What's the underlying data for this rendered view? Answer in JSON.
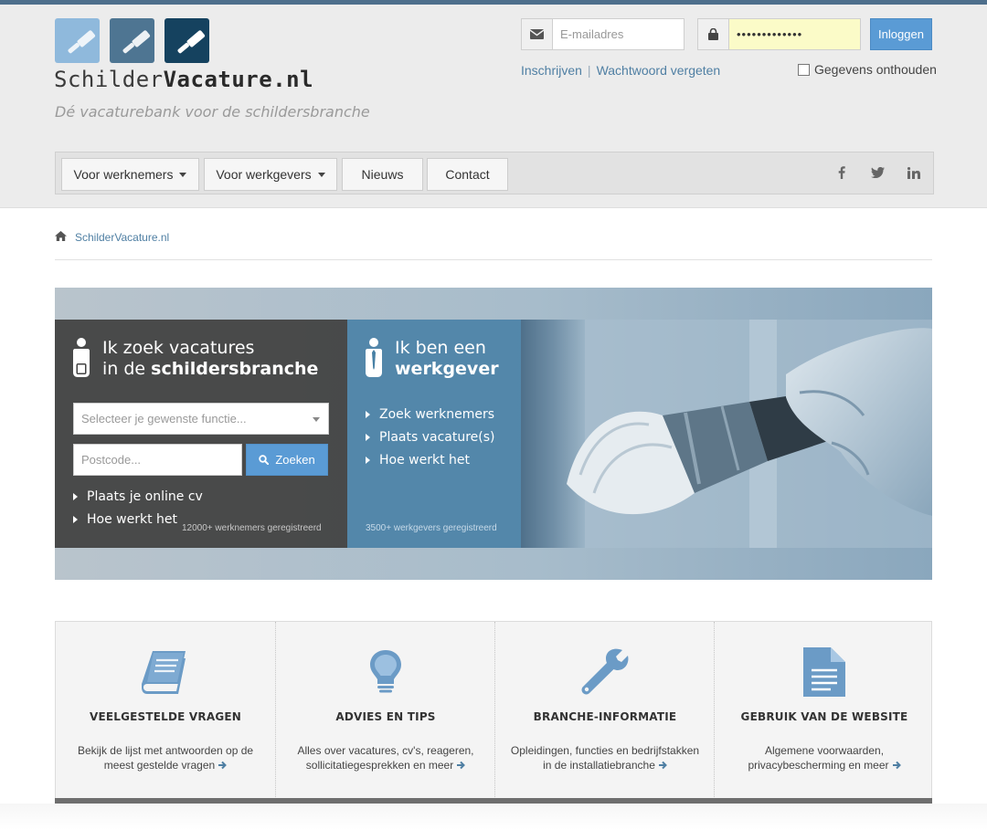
{
  "brand": {
    "logo_text_light": "Schilder",
    "logo_text_bold": "Vacature.nl",
    "tagline": "Dé vacaturebank voor de schildersbranche",
    "square_colors": [
      "#8fb9dc",
      "#4e7592",
      "#15425f"
    ]
  },
  "login": {
    "email_placeholder": "E-mailadres",
    "password_value": "•••••••••••••",
    "login_label": "Inloggen",
    "register_link": "Inschrijven",
    "separator": "|",
    "forgot_link": "Wachtwoord vergeten",
    "remember_label": "Gegevens onthouden"
  },
  "nav": {
    "items": [
      {
        "label": "Voor werknemers",
        "dropdown": true
      },
      {
        "label": "Voor werkgevers",
        "dropdown": true
      },
      {
        "label": "Nieuws",
        "dropdown": false
      },
      {
        "label": "Contact",
        "dropdown": false
      }
    ],
    "social_icons": [
      "facebook-icon",
      "twitter-icon",
      "linkedin-icon"
    ]
  },
  "breadcrumb": {
    "home_icon": "home-icon",
    "current": "SchilderVacature.nl"
  },
  "hero": {
    "seeker": {
      "title_line1": "Ik zoek vacatures",
      "title_line2_prefix": "in de ",
      "title_line2_bold": "schildersbranche",
      "select_placeholder": "Selecteer je gewenste functie...",
      "postcode_placeholder": "Postcode...",
      "search_label": "Zoeken",
      "links": [
        "Plaats je online cv",
        "Hoe werkt het"
      ],
      "count": "12000+ werknemers geregistreerd"
    },
    "employer": {
      "title_line1": "Ik ben een",
      "title_line2_bold": "werkgever",
      "links": [
        "Zoek werknemers",
        "Plaats vacature(s)",
        "Hoe werkt het"
      ],
      "count": "3500+ werkgevers geregistreerd"
    }
  },
  "features": [
    {
      "icon": "book-icon",
      "title": "VEELGESTELDE VRAGEN",
      "desc": "Bekijk de lijst met antwoorden op de meest gestelde vragen"
    },
    {
      "icon": "lightbulb-icon",
      "title": "ADVIES EN TIPS",
      "desc": "Alles over vacatures, cv's, reageren, sollicitatiegesprekken en meer"
    },
    {
      "icon": "wrench-icon",
      "title": "BRANCHE-INFORMATIE",
      "desc": "Opleidingen, functies en bedrijfstakken in de installatiebranche"
    },
    {
      "icon": "document-icon",
      "title": "GEBRUIK VAN DE WEBSITE",
      "desc": "Algemene voorwaarden, privacybescherming en meer"
    }
  ],
  "colors": {
    "accent": "#5a9bd5",
    "link": "#4f7fa3",
    "icon_blue": "#6b9bc6",
    "panel_dark": "#424242",
    "panel_blue": "#4780a5"
  }
}
